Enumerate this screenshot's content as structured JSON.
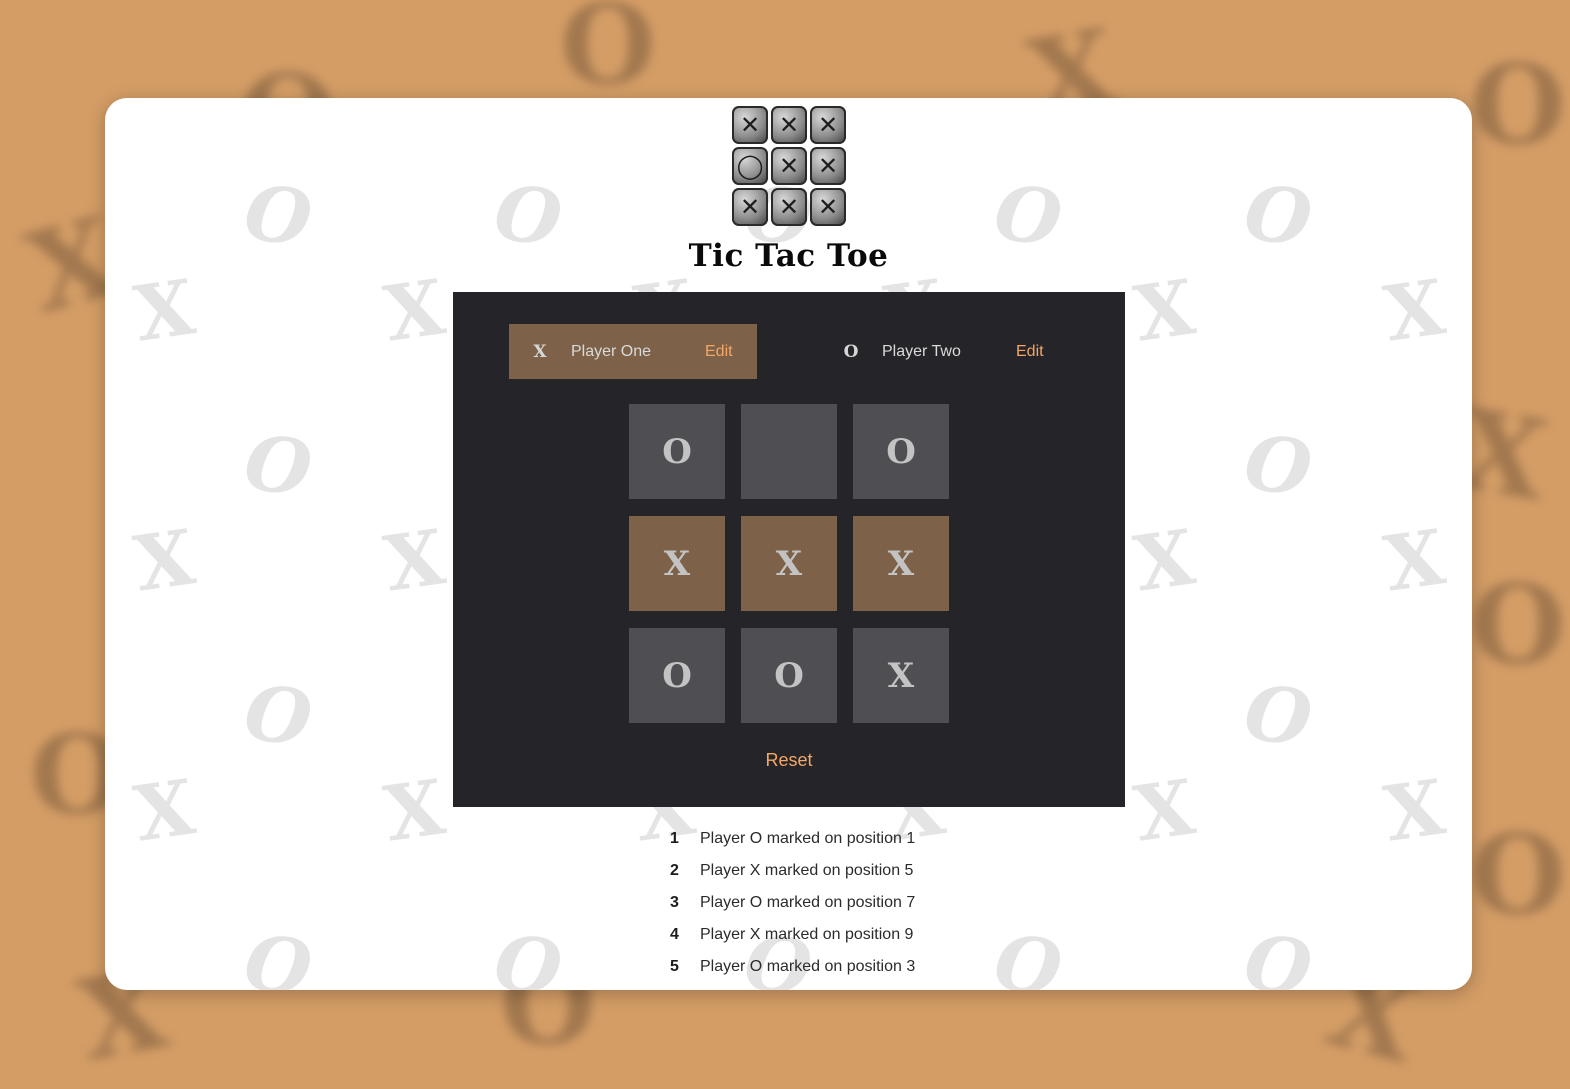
{
  "app": {
    "title": "Tic Tac Toe"
  },
  "logo": {
    "tiles": [
      "✕",
      "✕",
      "✕",
      "◯",
      "✕",
      "✕",
      "✕",
      "✕",
      "✕"
    ]
  },
  "players": [
    {
      "symbol": "X",
      "name": "Player One",
      "edit_label": "Edit",
      "active": true
    },
    {
      "symbol": "O",
      "name": "Player Two",
      "edit_label": "Edit",
      "active": false
    }
  ],
  "board": {
    "cells": [
      "O",
      "",
      "O",
      "X",
      "X",
      "X",
      "O",
      "O",
      "X"
    ],
    "winning_cells": [
      3,
      4,
      5
    ]
  },
  "controls": {
    "reset_label": "Reset"
  },
  "log": [
    {
      "num": "1",
      "text": "Player O marked on position 1"
    },
    {
      "num": "2",
      "text": "Player X marked on position 5"
    },
    {
      "num": "3",
      "text": "Player O marked on position 7"
    },
    {
      "num": "4",
      "text": "Player X marked on position 9"
    },
    {
      "num": "5",
      "text": "Player O marked on position 3"
    }
  ],
  "colors": {
    "accent": "#f4a766",
    "active_bg": "#7d6249",
    "panel_bg": "#252428",
    "cell_bg": "#4f4e53",
    "page_bg": "#d49d66"
  }
}
